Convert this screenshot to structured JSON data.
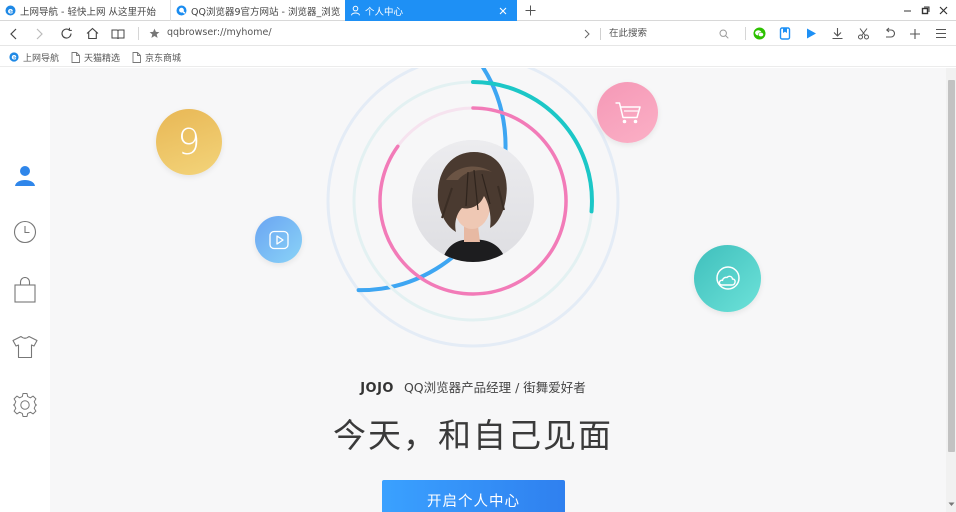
{
  "tabs": [
    {
      "label": "上网导航 - 轻快上网 从这里开始",
      "active": false,
      "icon": "ie-e-icon"
    },
    {
      "label": "QQ浏览器9官方网站 - 浏览器_浏览",
      "active": false,
      "icon": "qq-browser-icon"
    },
    {
      "label": "个人中心",
      "active": true,
      "icon": "person-icon"
    }
  ],
  "toolbar": {
    "url": "qqbrowser://myhome/",
    "search_placeholder": "在此搜索"
  },
  "bookmarks": [
    {
      "label": "上网导航",
      "icon": "ie-e-icon"
    },
    {
      "label": "天猫精选",
      "icon": "page-icon"
    },
    {
      "label": "京东商城",
      "icon": "page-icon"
    }
  ],
  "sidebar": {
    "items": [
      {
        "name": "profile",
        "icon": "person-icon",
        "active": true
      },
      {
        "name": "history",
        "icon": "clock-icon",
        "active": false
      },
      {
        "name": "shopping",
        "icon": "bag-icon",
        "active": false
      },
      {
        "name": "skins",
        "icon": "tshirt-icon",
        "active": false
      },
      {
        "name": "settings",
        "icon": "gear-icon",
        "active": false
      }
    ]
  },
  "profile": {
    "name": "JOJO",
    "description": "QQ浏览器产品经理 / 街舞爱好者",
    "tagline": "今天，和自己见面",
    "cta_label": "开启个人中心",
    "nine_badge": "9"
  },
  "colors": {
    "accent": "#1e90f5",
    "ring_blue": "#3ea6f2",
    "ring_teal": "#1cc7c7",
    "ring_pink": "#f27bb8",
    "bubble_gold": "#ecc25f",
    "bubble_pink": "#f7a2bd",
    "bubble_teal": "#4fd0cb",
    "bubble_blue": "#79b9f4"
  }
}
